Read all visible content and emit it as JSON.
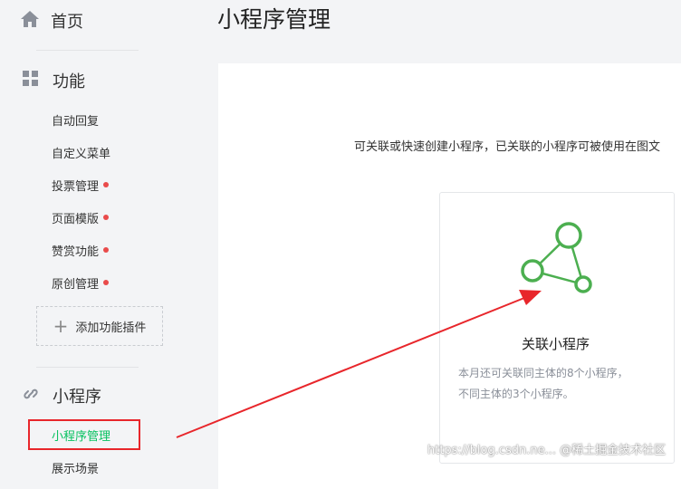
{
  "sidebar": {
    "home_label": "首页",
    "features_label": "功能",
    "feature_items": [
      {
        "label": "自动回复",
        "has_dot": false
      },
      {
        "label": "自定义菜单",
        "has_dot": false
      },
      {
        "label": "投票管理",
        "has_dot": true
      },
      {
        "label": "页面模版",
        "has_dot": true
      },
      {
        "label": "赞赏功能",
        "has_dot": true
      },
      {
        "label": "原创管理",
        "has_dot": true
      }
    ],
    "add_plugin_label": "添加功能插件",
    "miniprogram_label": "小程序",
    "miniprogram_items": [
      {
        "label": "小程序管理",
        "active": true
      },
      {
        "label": "展示场景",
        "active": false
      }
    ]
  },
  "main": {
    "title": "小程序管理",
    "intro_text": "可关联或快速创建小程序，已关联的小程序可被使用在图文",
    "card": {
      "title": "关联小程序",
      "description_line1": "本月还可关联同主体的8个小程序，",
      "description_line2": "不同主体的3个小程序。"
    }
  },
  "watermark": "https://blog.csdn.ne... @稀土掘金技术社区",
  "colors": {
    "accent_green": "#07c160",
    "icon_green": "#4caf50",
    "badge_red": "#e94b4b",
    "annotation_red": "#e8262b"
  },
  "icons": {
    "home": "home-icon",
    "features": "grid-icon",
    "miniprogram": "link-icon",
    "card": "network-icon",
    "add": "plus-icon"
  }
}
